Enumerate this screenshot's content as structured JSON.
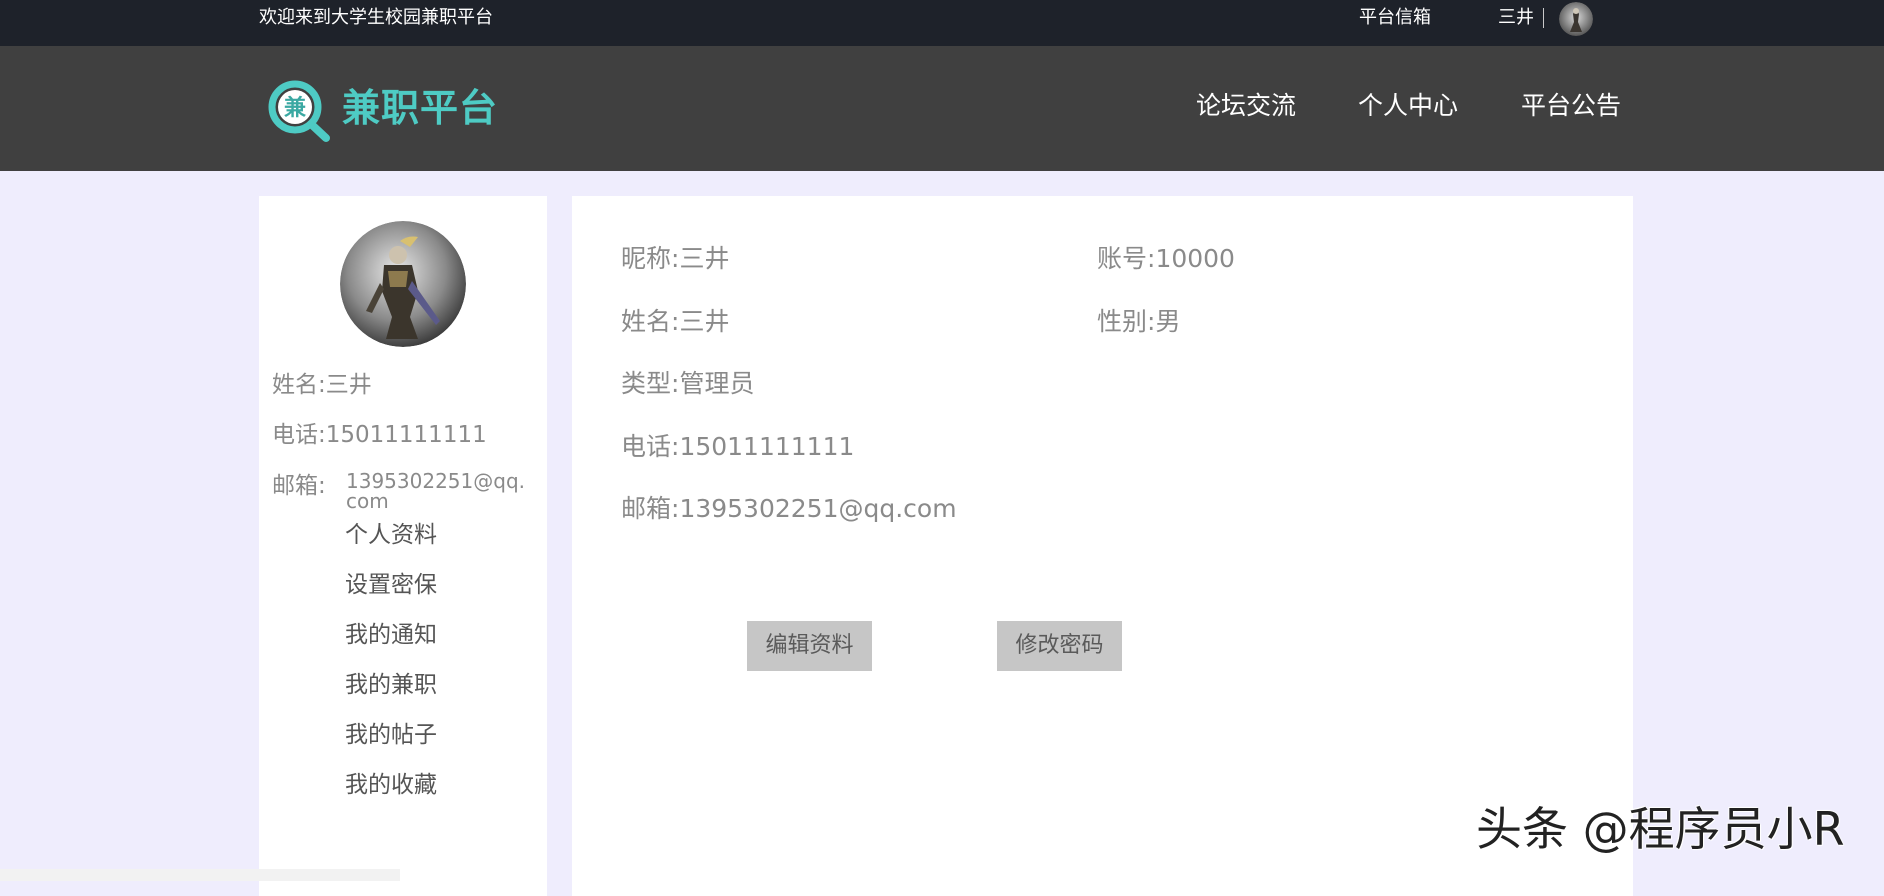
{
  "topbar": {
    "welcome": "欢迎来到大学生校园兼职平台",
    "inbox": "平台信箱",
    "user_name": "三井"
  },
  "brand": {
    "logo_glyph": "兼",
    "name": "兼职平台",
    "color": "#4ecbc4"
  },
  "nav": {
    "forum": "论坛交流",
    "personal_center": "个人中心",
    "announcements": "平台公告"
  },
  "sidebar": {
    "name_label": "姓名:",
    "name_value": "三井",
    "phone_label": "电话:",
    "phone_value": "15011111111",
    "email_label": "邮箱:",
    "email_value": "1395302251@qq.com",
    "menu": [
      "个人资料",
      "设置密保",
      "我的通知",
      "我的兼职",
      "我的帖子",
      "我的收藏"
    ]
  },
  "profile": {
    "nickname_label": "昵称:",
    "nickname_value": "三井",
    "account_label": "账号:",
    "account_value": "10000",
    "name_label": "姓名:",
    "name_value": "三井",
    "gender_label": "性别:",
    "gender_value": "男",
    "type_label": "类型:",
    "type_value": "管理员",
    "phone_label": "电话:",
    "phone_value": "15011111111",
    "email_label": "邮箱:",
    "email_value": "1395302251@qq.com"
  },
  "actions": {
    "edit_profile": "编辑资料",
    "change_password": "修改密码"
  },
  "watermark": "头条 @程序员小R",
  "colors": {
    "topbar_bg": "#1e222a",
    "header_bg": "#404040",
    "page_bg": "#efedfd",
    "button_bg": "#c6c6c6"
  }
}
